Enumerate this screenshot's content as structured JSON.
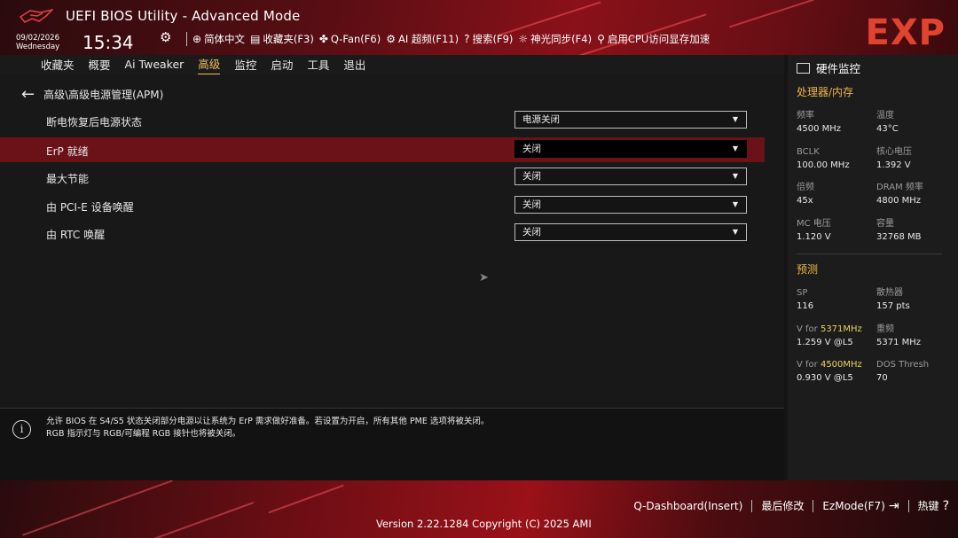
{
  "header": {
    "title": "UEFI BIOS Utility - Advanced Mode",
    "date": "09/02/2026",
    "weekday": "Wednesday",
    "time": "15:34",
    "brand_badge": "EXP",
    "toolbar": [
      {
        "icon": "globe-icon",
        "glyph": "⊕",
        "label": "简体中文"
      },
      {
        "icon": "bookmark-icon",
        "glyph": "▤",
        "label": "收藏夹(F3)"
      },
      {
        "icon": "fan-icon",
        "glyph": "✤",
        "label": "Q-Fan(F6)"
      },
      {
        "icon": "ai-overclock-icon",
        "glyph": "⚙",
        "label": "AI 超频(F11)"
      },
      {
        "icon": "search-icon",
        "glyph": "?",
        "label": "搜索(F9)"
      },
      {
        "icon": "aura-sync-icon",
        "glyph": "☼",
        "label": "神光同步(F4)"
      },
      {
        "icon": "resize-bar-icon",
        "glyph": "⚲",
        "label": "启用CPU访问显存加速"
      }
    ]
  },
  "nav": {
    "items": [
      "收藏夹",
      "概要",
      "Ai Tweaker",
      "高级",
      "监控",
      "启动",
      "工具",
      "退出"
    ],
    "active_index": 3
  },
  "main": {
    "breadcrumb": "高级\\高级电源管理(APM)",
    "rows": [
      {
        "label": "断电恢复后电源状态",
        "value": "电源关闭"
      },
      {
        "label": "ErP 就绪",
        "value": "关闭"
      },
      {
        "label": "最大节能",
        "value": "关闭"
      },
      {
        "label": "由 PCI-E 设备唤醒",
        "value": "关闭"
      },
      {
        "label": "由 RTC 唤醒",
        "value": "关闭"
      }
    ],
    "selected_index": 1
  },
  "help": {
    "line1": "允许 BIOS 在 S4/S5 状态关闭部分电源以让系统为 ErP 需求做好准备。若设置为开启，所有其他 PME 选项将被关闭。",
    "line2": "RGB 指示灯与 RGB/可编程 RGB 接针也将被关闭。"
  },
  "monitor": {
    "title": "硬件监控",
    "cpu_section": "处理器/内存",
    "cpu_stats": [
      {
        "key": "频率",
        "value": "4500 MHz"
      },
      {
        "key": "温度",
        "value": "43°C"
      },
      {
        "key": "BCLK",
        "value": "100.00 MHz"
      },
      {
        "key": "核心电压",
        "value": "1.392 V"
      },
      {
        "key": "倍频",
        "value": "45x"
      },
      {
        "key": "DRAM 频率",
        "value": "4800 MHz"
      },
      {
        "key": "MC 电压",
        "value": "1.120 V"
      },
      {
        "key": "容量",
        "value": "32768 MB"
      }
    ],
    "predict_section": "预测",
    "predict_stats": [
      {
        "key": "SP",
        "value": "116"
      },
      {
        "key": "散热器",
        "value": "157 pts"
      },
      {
        "key_prefix": "V for ",
        "key_highlight": "5371MHz",
        "value": "1.259 V @L5"
      },
      {
        "key": "重频",
        "value": "5371 MHz"
      },
      {
        "key_prefix": "V for ",
        "key_highlight": "4500MHz",
        "value": "0.930 V @L5"
      },
      {
        "key": "DOS Thresh",
        "value": "70"
      }
    ]
  },
  "footer": {
    "qdashboard": "Q-Dashboard(Insert)",
    "last_modified": "最后修改",
    "ezmode": "EzMode(F7)",
    "hotkeys": "热键",
    "version": "Version 2.22.1284 Copyright (C) 2025 AMI"
  }
}
